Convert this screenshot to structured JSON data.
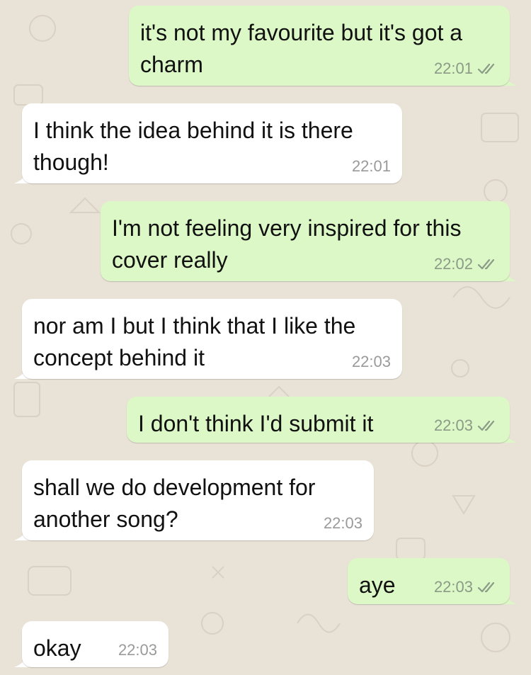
{
  "conversation": {
    "messages": [
      {
        "direction": "outgoing",
        "text_lines": [
          "it's not my favourite but it's got a",
          "charm"
        ],
        "time": "22:01",
        "status_icon": "double-check-icon"
      },
      {
        "direction": "incoming",
        "text_lines": [
          "I think the idea behind it is there",
          "though!"
        ],
        "time": "22:01"
      },
      {
        "direction": "outgoing",
        "text_lines": [
          "I'm not feeling very inspired for this",
          "cover really"
        ],
        "time": "22:02",
        "status_icon": "double-check-icon"
      },
      {
        "direction": "incoming",
        "text_lines": [
          "nor am I but I think that I like the",
          "concept behind it"
        ],
        "time": "22:03"
      },
      {
        "direction": "outgoing",
        "text_lines": [
          "I don't think I'd submit it"
        ],
        "time": "22:03",
        "status_icon": "double-check-icon"
      },
      {
        "direction": "incoming",
        "text_lines": [
          "shall we do development for",
          "another song?"
        ],
        "time": "22:03"
      },
      {
        "direction": "outgoing",
        "text_lines": [
          "aye"
        ],
        "time": "22:03",
        "status_icon": "double-check-icon"
      },
      {
        "direction": "incoming",
        "text_lines": [
          "okay"
        ],
        "time": "22:03"
      }
    ]
  },
  "colors": {
    "wallpaper": "#e9e2d6",
    "outgoing_bubble": "#dcf8c6",
    "incoming_bubble": "#ffffff",
    "timestamp": "#8c9a88"
  }
}
